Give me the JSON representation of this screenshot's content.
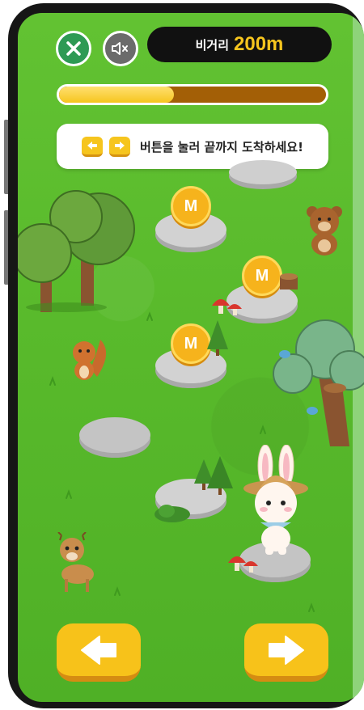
{
  "hud": {
    "close_icon": "close-x-icon",
    "mute_icon": "speaker-muted-icon",
    "distance_label": "비거리",
    "distance_value": "200m"
  },
  "progress": {
    "fraction": 0.43,
    "fill_color": "#f6c51e",
    "track_color": "#a35f06"
  },
  "instruction": {
    "icons": [
      "left-arrow-icon",
      "right-arrow-icon"
    ],
    "text": "버튼을 눌러 끝까지 도착하세요!"
  },
  "coins": [
    {
      "label": "M"
    },
    {
      "label": "M"
    },
    {
      "label": "M"
    }
  ],
  "controls": {
    "left_icon": "left-arrow-icon",
    "right_icon": "right-arrow-icon",
    "button_color": "#f7c21a"
  },
  "characters": [
    "bunny",
    "bear",
    "squirrel",
    "deer"
  ]
}
